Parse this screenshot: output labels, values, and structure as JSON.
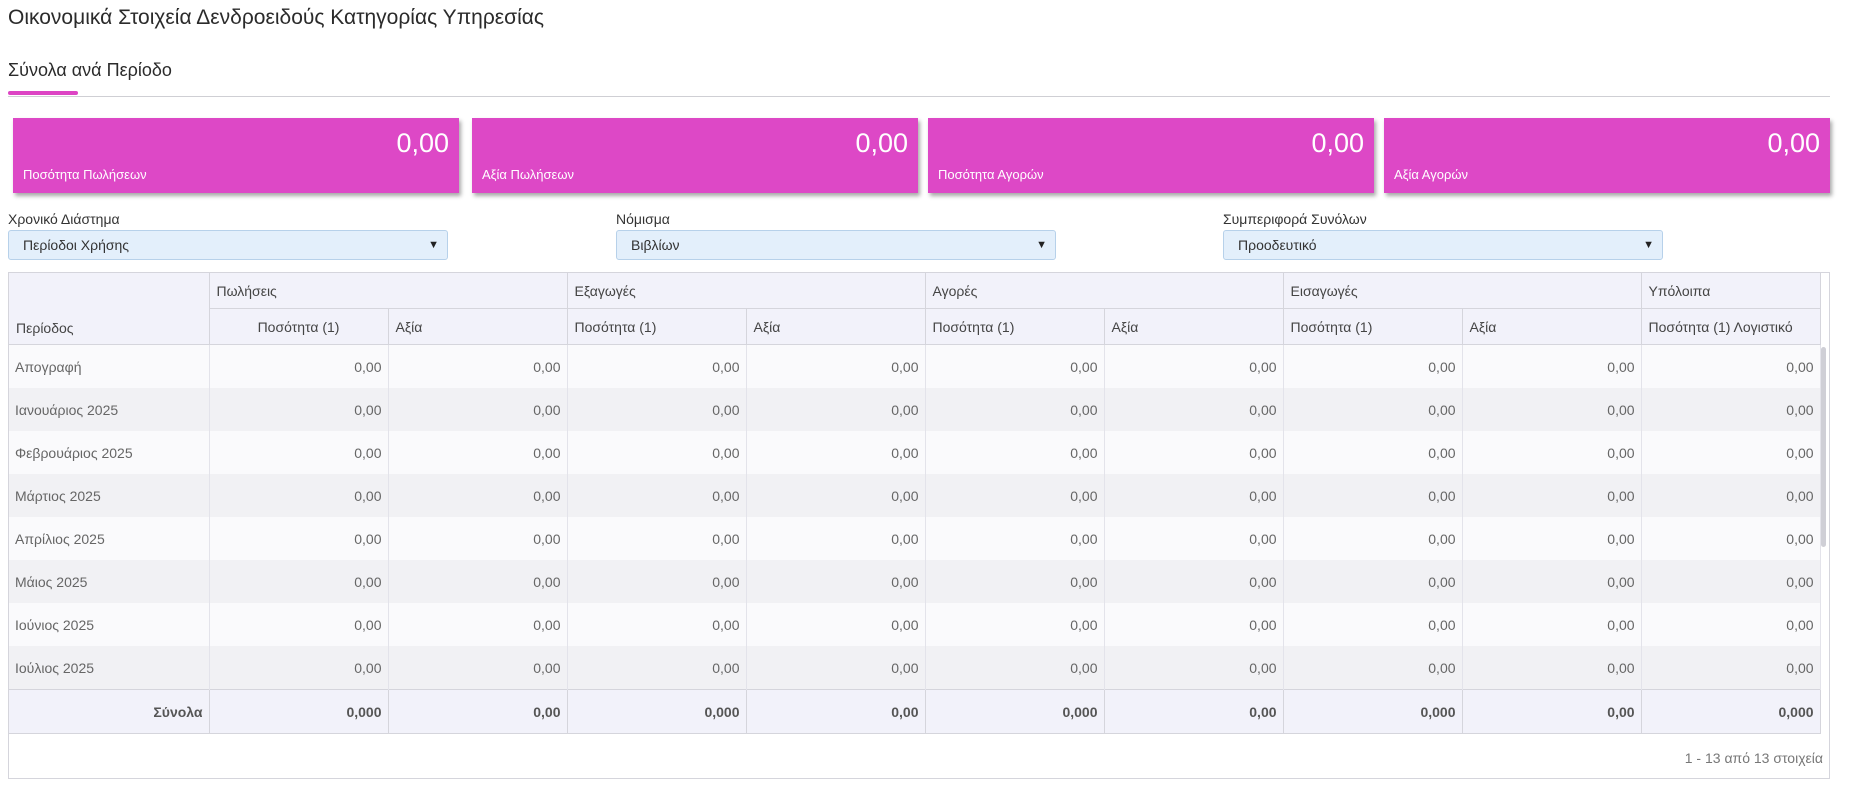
{
  "page": {
    "title": "Οικονομικά Στοιχεία Δενδροειδούς Κατηγορίας Υπηρεσίας"
  },
  "tab": {
    "label": "Σύνολα ανά Περίοδο"
  },
  "colors": {
    "accent": "#dd48c6",
    "select_bg": "#e3effb"
  },
  "cards": [
    {
      "value": "0,00",
      "label": "Ποσότητα Πωλήσεων"
    },
    {
      "value": "0,00",
      "label": "Αξία Πωλήσεων"
    },
    {
      "value": "0,00",
      "label": "Ποσότητα Αγορών"
    },
    {
      "value": "0,00",
      "label": "Αξία Αγορών"
    }
  ],
  "filters": [
    {
      "label": "Χρονικό Διάστημα",
      "value": "Περίοδοι Χρήσης"
    },
    {
      "label": "Νόμισμα",
      "value": "Βιβλίων"
    },
    {
      "label": "Συμπεριφορά Συνόλων",
      "value": "Προοδευτικό"
    }
  ],
  "dropdown_icon": "caret-down-icon",
  "grid": {
    "period_header": "Περίοδος",
    "groups": [
      "Πωλήσεις",
      "Εξαγωγές",
      "Αγορές",
      "Εισαγωγές",
      "Υπόλοιπα"
    ],
    "subheaders": [
      "Ποσότητα (1)",
      "Αξία",
      "Ποσότητα (1)",
      "Αξία",
      "Ποσότητα (1)",
      "Αξία",
      "Ποσότητα (1)",
      "Αξία",
      "Ποσότητα (1) Λογιστικό"
    ],
    "rows": [
      {
        "period": "Απογραφή",
        "cells": [
          "0,00",
          "0,00",
          "0,00",
          "0,00",
          "0,00",
          "0,00",
          "0,00",
          "0,00",
          "0,00"
        ]
      },
      {
        "period": "Ιανουάριος 2025",
        "cells": [
          "0,00",
          "0,00",
          "0,00",
          "0,00",
          "0,00",
          "0,00",
          "0,00",
          "0,00",
          "0,00"
        ]
      },
      {
        "period": "Φεβρουάριος 2025",
        "cells": [
          "0,00",
          "0,00",
          "0,00",
          "0,00",
          "0,00",
          "0,00",
          "0,00",
          "0,00",
          "0,00"
        ]
      },
      {
        "period": "Μάρτιος 2025",
        "cells": [
          "0,00",
          "0,00",
          "0,00",
          "0,00",
          "0,00",
          "0,00",
          "0,00",
          "0,00",
          "0,00"
        ]
      },
      {
        "period": "Απρίλιος 2025",
        "cells": [
          "0,00",
          "0,00",
          "0,00",
          "0,00",
          "0,00",
          "0,00",
          "0,00",
          "0,00",
          "0,00"
        ]
      },
      {
        "period": "Μάιος 2025",
        "cells": [
          "0,00",
          "0,00",
          "0,00",
          "0,00",
          "0,00",
          "0,00",
          "0,00",
          "0,00",
          "0,00"
        ]
      },
      {
        "period": "Ιούνιος 2025",
        "cells": [
          "0,00",
          "0,00",
          "0,00",
          "0,00",
          "0,00",
          "0,00",
          "0,00",
          "0,00",
          "0,00"
        ]
      },
      {
        "period": "Ιούλιος 2025",
        "cells": [
          "0,00",
          "0,00",
          "0,00",
          "0,00",
          "0,00",
          "0,00",
          "0,00",
          "0,00",
          "0,00"
        ]
      }
    ],
    "totals": {
      "label": "Σύνολα",
      "cells": [
        "0,000",
        "0,00",
        "0,000",
        "0,00",
        "0,000",
        "0,00",
        "0,000",
        "0,00",
        "0,000"
      ]
    },
    "pager": "1 - 13 από 13 στοιχεία"
  }
}
